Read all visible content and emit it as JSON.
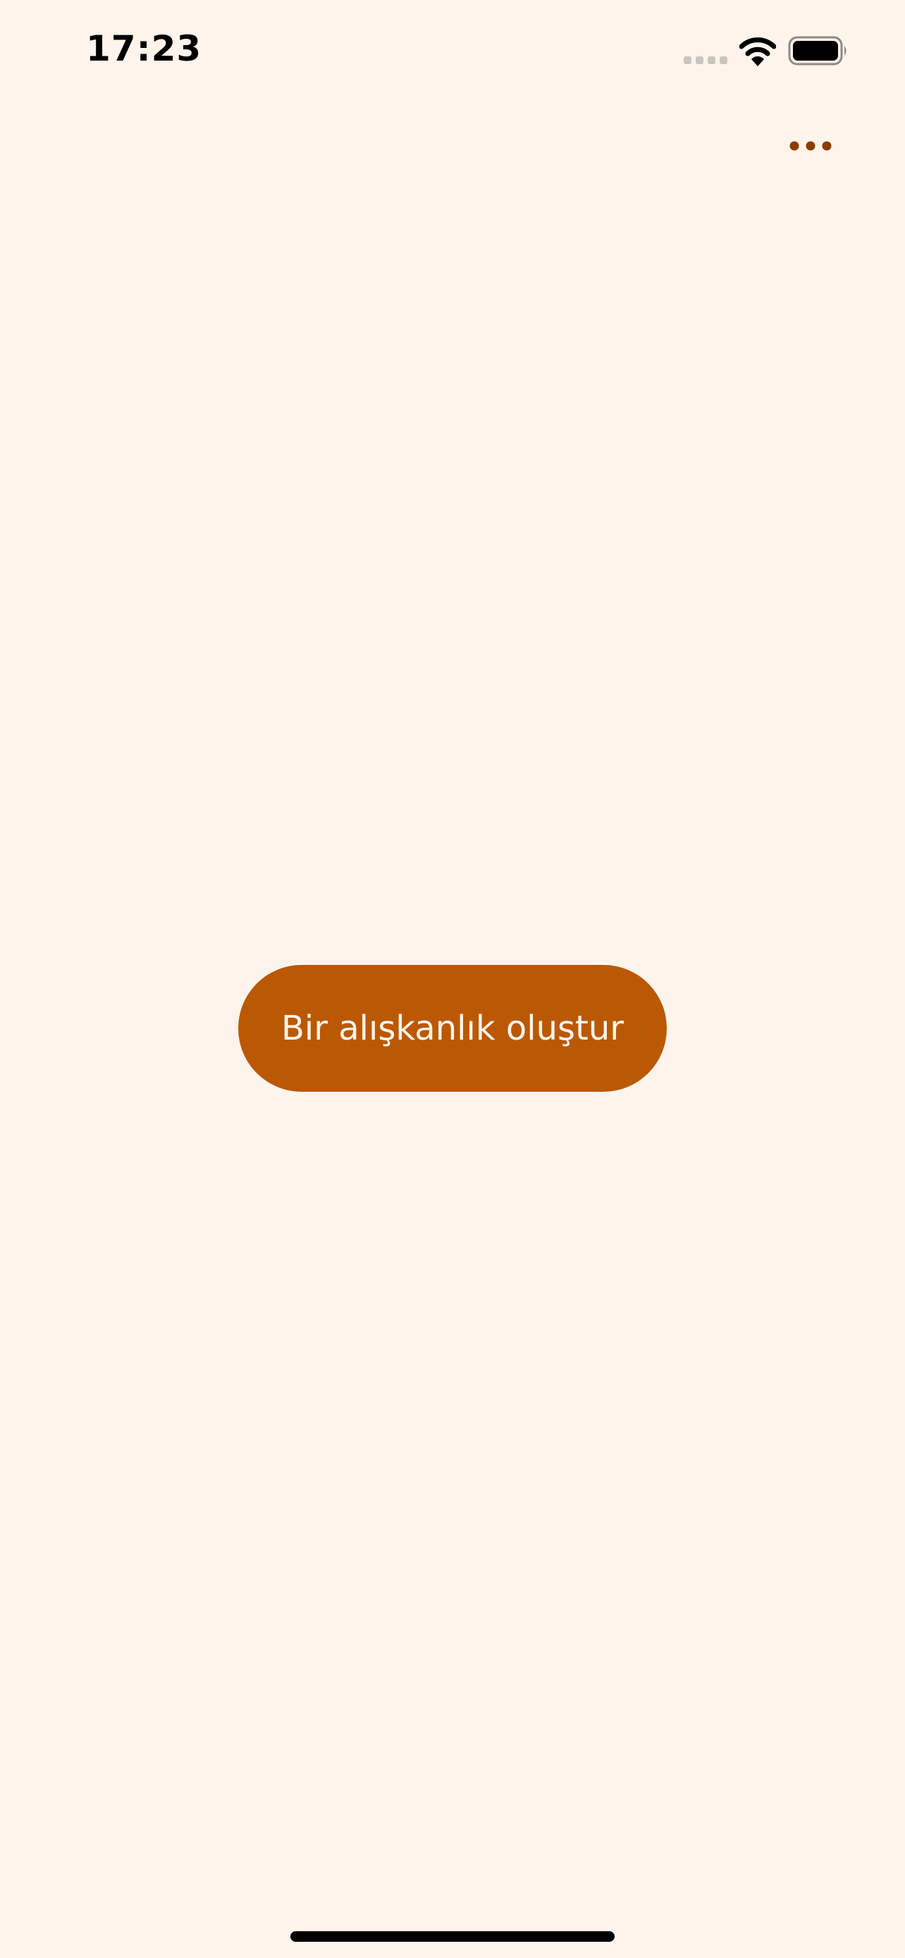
{
  "status_bar": {
    "time": "17:23",
    "signal_icon": "cellular-signal-icon",
    "wifi_icon": "wifi-icon",
    "battery_icon": "battery-icon",
    "battery_level": 1.0
  },
  "header": {
    "more_icon": "ellipsis-icon"
  },
  "main": {
    "create_habit_label": "Bir alışkanlık oluştur"
  },
  "colors": {
    "background": "#fef4ec",
    "accent": "#bb5804",
    "more_icon": "#8a3d00",
    "button_text": "#fef4ec"
  }
}
